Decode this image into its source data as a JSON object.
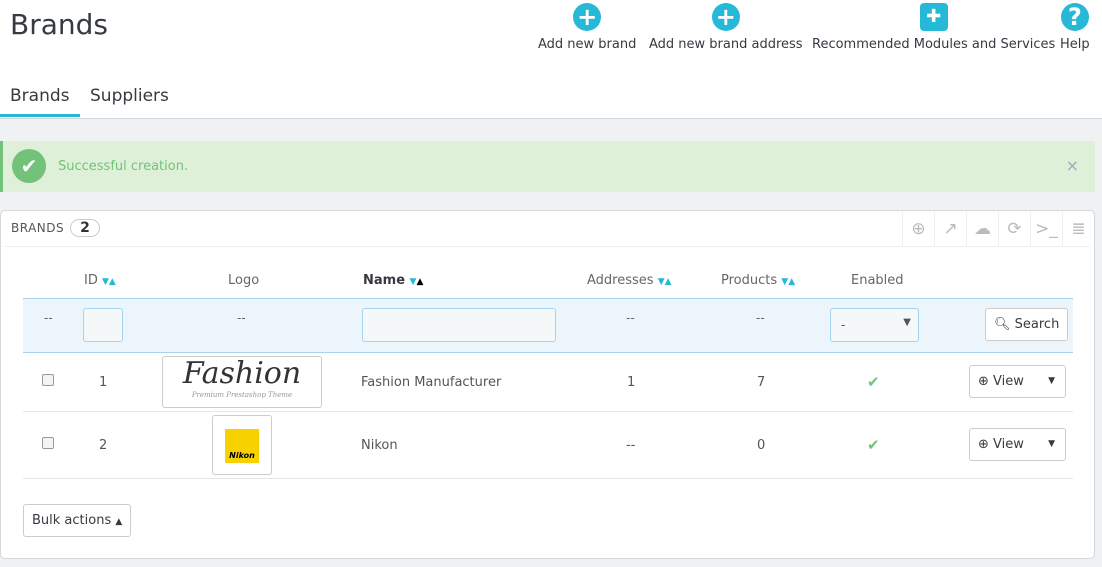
{
  "header": {
    "title": "Brands",
    "toolbar": [
      {
        "label": "Add new brand",
        "icon": "plus-circle-icon"
      },
      {
        "label": "Add new brand address",
        "icon": "plus-circle-icon"
      },
      {
        "label": "Recommended Modules and Services",
        "icon": "puzzle-icon"
      },
      {
        "label": "Help",
        "icon": "question-circle-icon"
      }
    ]
  },
  "tabs": [
    {
      "label": "Brands",
      "active": true
    },
    {
      "label": "Suppliers",
      "active": false
    }
  ],
  "alert": {
    "message": "Successful creation.",
    "close": "×"
  },
  "panel": {
    "title": "BRANDS",
    "count": "2",
    "columns": [
      "ID",
      "Logo",
      "Name",
      "Addresses",
      "Products",
      "Enabled"
    ],
    "filters": {
      "empty": "--",
      "enabled_value": "-",
      "search_label": "Search"
    },
    "rows": [
      {
        "id": "1",
        "logo": "Fashion",
        "logo_sub": "Premium Prestashop Theme",
        "name": "Fashion Manufacturer",
        "addresses": "1",
        "products": "7",
        "enabled": true,
        "action": "View"
      },
      {
        "id": "2",
        "logo": "Nikon",
        "name": "Nikon",
        "addresses": "--",
        "products": "0",
        "enabled": true,
        "action": "View"
      }
    ],
    "bulk_label": "Bulk actions"
  },
  "colors": {
    "accent": "#25b9d7",
    "success": "#72c279"
  }
}
